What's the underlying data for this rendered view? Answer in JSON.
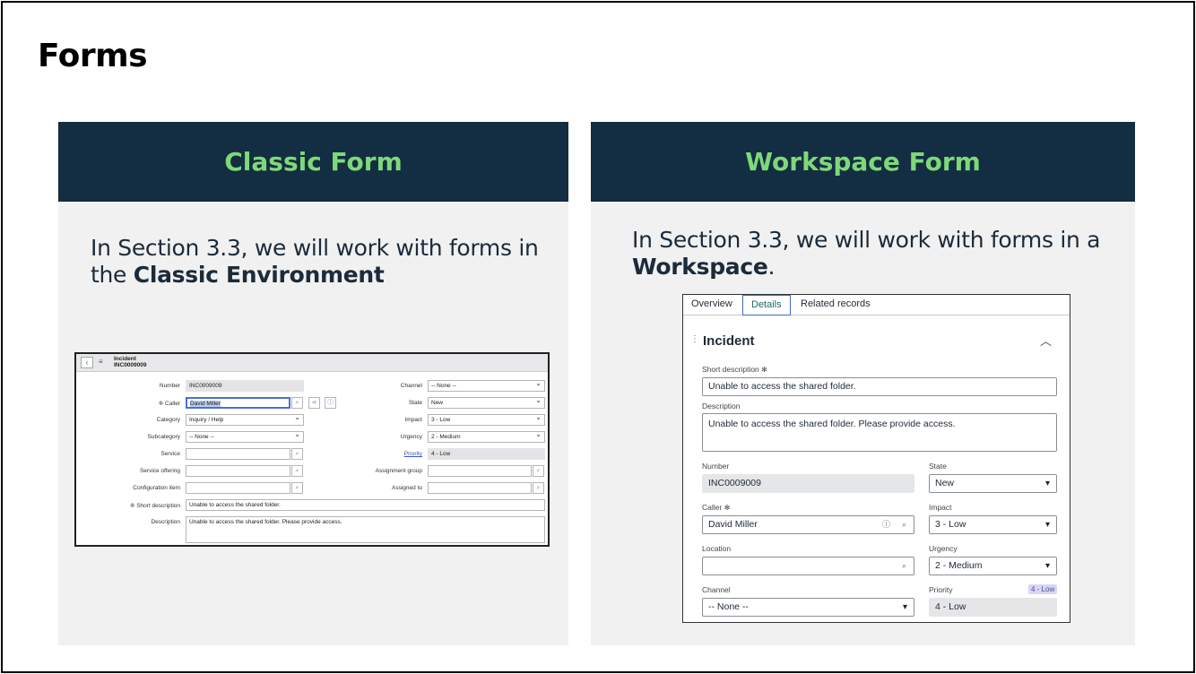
{
  "slide": {
    "title": "Forms"
  },
  "classic_panel": {
    "heading": "Classic Form",
    "text_before": "In Section 3.3, we will work with forms in the ",
    "text_bold": "Classic Environment",
    "form": {
      "record_type": "Incident",
      "record_number": "INC0009009",
      "labels": {
        "number": "Number",
        "caller": "Caller",
        "category": "Category",
        "subcategory": "Subcategory",
        "service": "Service",
        "service_offering": "Service offering",
        "configuration_item": "Configuration item",
        "short_description": "Short description",
        "description": "Description",
        "channel": "Channel",
        "state": "State",
        "impact": "Impact",
        "urgency": "Urgency",
        "priority": "Priority",
        "assignment_group": "Assignment group",
        "assigned_to": "Assigned to"
      },
      "values": {
        "number": "INC0009009",
        "caller": "David Miller",
        "category": "Inquiry / Help",
        "subcategory": "-- None --",
        "short_description": "Unable to access the shared folder.",
        "description": "Unable to access the shared folder. Please provide access.",
        "channel": "-- None --",
        "state": "New",
        "impact": "3 - Low",
        "urgency": "2 - Medium",
        "priority": "4 - Low"
      }
    }
  },
  "workspace_panel": {
    "heading": "Workspace Form",
    "text_before": "In Section 3.3, we will work with forms in a ",
    "text_bold": "Workspace",
    "text_after": ".",
    "form": {
      "tabs": [
        "Overview",
        "Details",
        "Related records"
      ],
      "active_tab": "Details",
      "section_title": "Incident",
      "labels": {
        "short_description": "Short description",
        "description": "Description",
        "number": "Number",
        "state": "State",
        "caller": "Caller",
        "impact": "Impact",
        "location": "Location",
        "urgency": "Urgency",
        "channel": "Channel",
        "priority": "Priority"
      },
      "values": {
        "short_description": "Unable to access the shared folder.",
        "description": "Unable to access the shared folder. Please provide access.",
        "number": "INC0009009",
        "state": "New",
        "caller": "David Miller",
        "impact": "3 - Low",
        "location": "",
        "urgency": "2 - Medium",
        "channel": "-- None --",
        "priority": "4 - Low",
        "priority_badge": "4 - Low"
      }
    }
  },
  "colors": {
    "panel_header_bg": "#132d42",
    "panel_header_text": "#7fd878",
    "panel_bg": "#f1f1f2"
  }
}
